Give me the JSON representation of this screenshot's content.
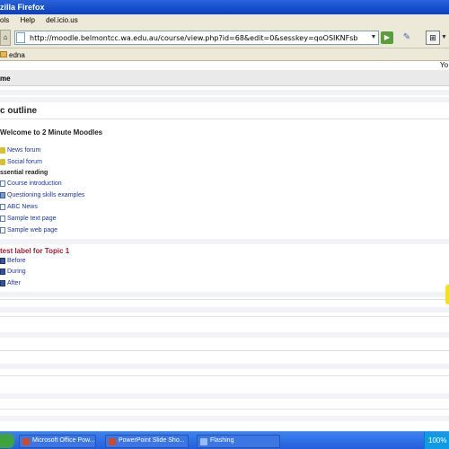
{
  "window": {
    "title": "zilla Firefox"
  },
  "menu": {
    "items": [
      "ols",
      "Help",
      "del.icio.us"
    ]
  },
  "nav": {
    "url": "http://moodle.belmontcc.wa.edu.au/course/view.php?id=68&edit=0&sesskey=qoOSIKNFsb"
  },
  "bookmarks": {
    "folder_label": "edna"
  },
  "login": {
    "text": "Yo"
  },
  "breadcrumb": {
    "text": "me"
  },
  "course": {
    "outline_heading": "c outline",
    "welcome_heading": "Welcome to 2 Minute Moodles",
    "forums": [
      {
        "label": "News forum"
      },
      {
        "label": "Social forum"
      }
    ],
    "essential_heading": "ssential reading",
    "resources": [
      {
        "label": "Course introduction",
        "icon": "page-icon"
      },
      {
        "label": "Questioning skills examples",
        "icon": "file-icon"
      },
      {
        "label": "ABC News",
        "icon": "page-icon"
      },
      {
        "label": "Sample text page",
        "icon": "page-icon"
      },
      {
        "label": "Sample web page",
        "icon": "page-icon"
      }
    ],
    "topic_label": "test label for Topic 1",
    "videos": [
      {
        "label": "Before"
      },
      {
        "label": "During"
      },
      {
        "label": "After"
      }
    ]
  },
  "taskbar": {
    "tasks": [
      {
        "label": "Microsoft Office Pow..."
      },
      {
        "label": "PowerPoint Slide Sho..."
      },
      {
        "label": "Flashing"
      }
    ],
    "tray_text": "100%"
  }
}
